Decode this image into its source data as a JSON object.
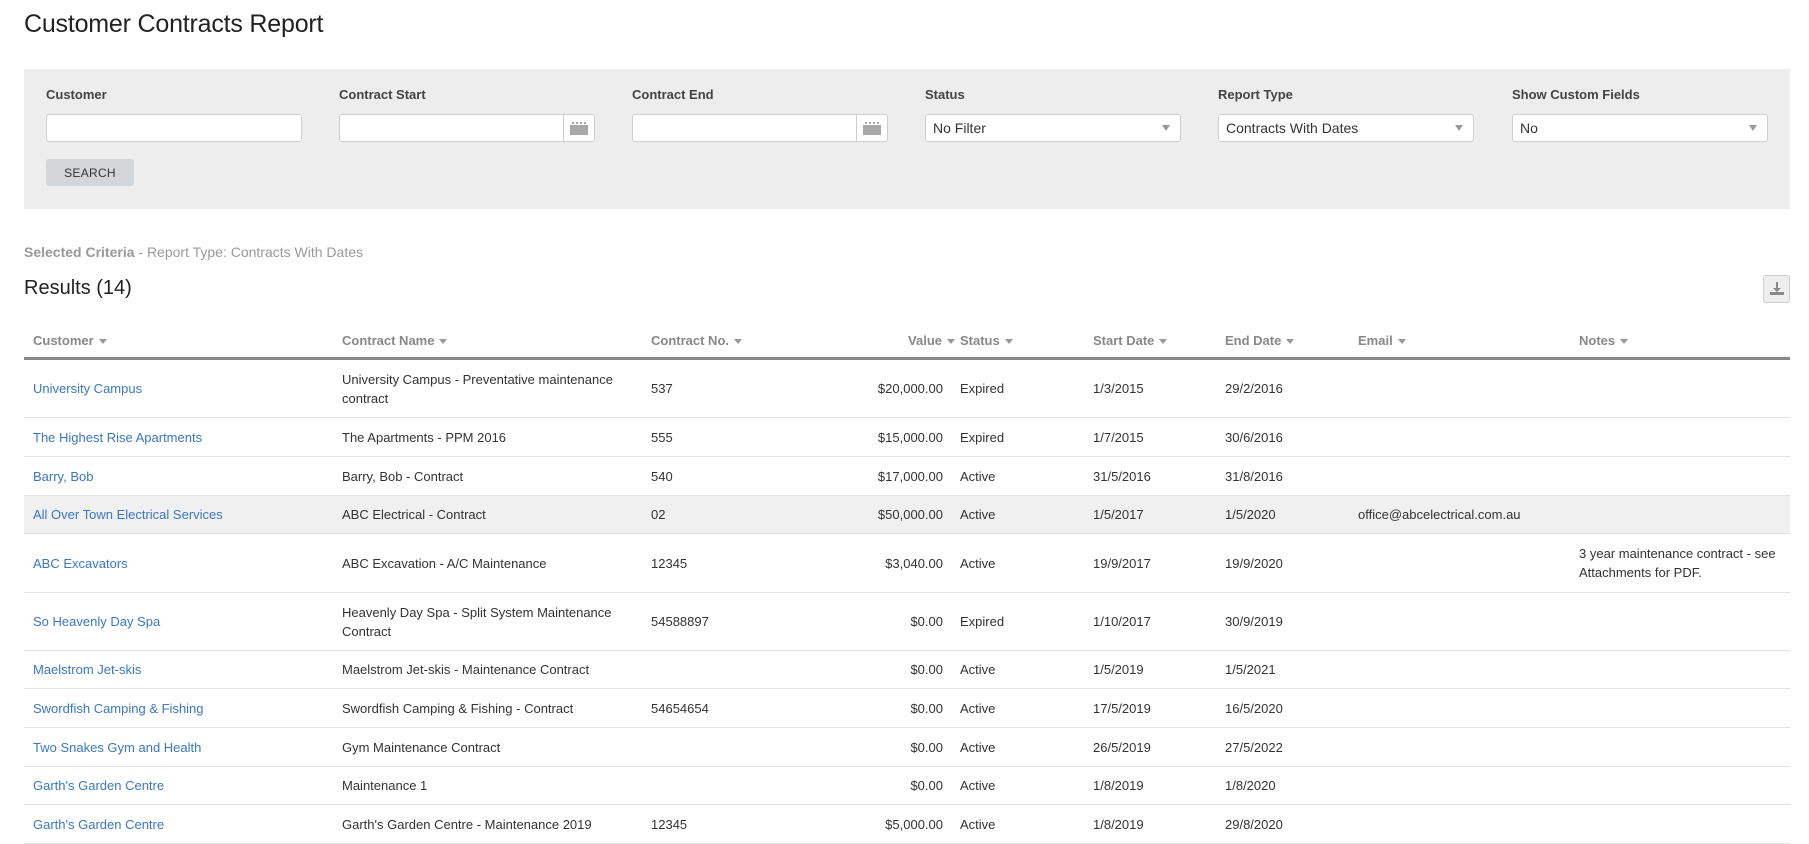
{
  "page": {
    "title": "Customer Contracts Report"
  },
  "filters": {
    "customer": {
      "label": "Customer",
      "value": ""
    },
    "contract_start": {
      "label": "Contract Start",
      "value": "",
      "icon": "calendar-icon"
    },
    "contract_end": {
      "label": "Contract End",
      "value": "",
      "icon": "calendar-icon"
    },
    "status": {
      "label": "Status",
      "selected": "No Filter"
    },
    "report_type": {
      "label": "Report Type",
      "selected": "Contracts With Dates"
    },
    "show_custom_fields": {
      "label": "Show Custom Fields",
      "selected": "No"
    },
    "search_label": "SEARCH"
  },
  "criteria": {
    "label": "Selected Criteria",
    "text": " - Report Type: Contracts With Dates"
  },
  "results": {
    "title": "Results (14)",
    "download_icon": "download-icon"
  },
  "table": {
    "columns": [
      "Customer",
      "Contract Name",
      "Contract No.",
      "Value",
      "Status",
      "Start Date",
      "End Date",
      "Email",
      "Notes"
    ],
    "rows": [
      {
        "customer": "University Campus",
        "name": "University Campus - Preventative maintenance contract",
        "no": "537",
        "value": "$20,000.00",
        "status": "Expired",
        "start": "1/3/2015",
        "end": "29/2/2016",
        "email": "",
        "notes": ""
      },
      {
        "customer": "The Highest Rise Apartments",
        "name": "The Apartments - PPM 2016",
        "no": "555",
        "value": "$15,000.00",
        "status": "Expired",
        "start": "1/7/2015",
        "end": "30/6/2016",
        "email": "",
        "notes": ""
      },
      {
        "customer": "Barry, Bob",
        "name": "Barry, Bob - Contract",
        "no": "540",
        "value": "$17,000.00",
        "status": "Active",
        "start": "31/5/2016",
        "end": "31/8/2016",
        "email": "",
        "notes": ""
      },
      {
        "customer": "All Over Town Electrical Services",
        "name": "ABC Electrical - Contract",
        "no": "02",
        "value": "$50,000.00",
        "status": "Active",
        "start": "1/5/2017",
        "end": "1/5/2020",
        "email": "office@abcelectrical.com.au",
        "notes": ""
      },
      {
        "customer": "ABC Excavators",
        "name": "ABC Excavation - A/C Maintenance",
        "no": "12345",
        "value": "$3,040.00",
        "status": "Active",
        "start": "19/9/2017",
        "end": "19/9/2020",
        "email": "",
        "notes": "3 year maintenance contract - see Attachments for PDF."
      },
      {
        "customer": "So Heavenly Day Spa",
        "name": "Heavenly Day Spa - Split System Maintenance Contract",
        "no": "54588897",
        "value": "$0.00",
        "status": "Expired",
        "start": "1/10/2017",
        "end": "30/9/2019",
        "email": "",
        "notes": ""
      },
      {
        "customer": "Maelstrom Jet-skis",
        "name": "Maelstrom Jet-skis - Maintenance Contract",
        "no": "",
        "value": "$0.00",
        "status": "Active",
        "start": "1/5/2019",
        "end": "1/5/2021",
        "email": "",
        "notes": ""
      },
      {
        "customer": "Swordfish Camping & Fishing",
        "name": "Swordfish Camping & Fishing - Contract",
        "no": "54654654",
        "value": "$0.00",
        "status": "Active",
        "start": "17/5/2019",
        "end": "16/5/2020",
        "email": "",
        "notes": ""
      },
      {
        "customer": "Two Snakes Gym and Health",
        "name": "Gym Maintenance Contract",
        "no": "",
        "value": "$0.00",
        "status": "Active",
        "start": "26/5/2019",
        "end": "27/5/2022",
        "email": "",
        "notes": ""
      },
      {
        "customer": "Garth's Garden Centre",
        "name": "Maintenance 1",
        "no": "",
        "value": "$0.00",
        "status": "Active",
        "start": "1/8/2019",
        "end": "1/8/2020",
        "email": "",
        "notes": ""
      },
      {
        "customer": "Garth's Garden Centre",
        "name": "Garth's Garden Centre - Maintenance 2019",
        "no": "12345",
        "value": "$5,000.00",
        "status": "Active",
        "start": "1/8/2019",
        "end": "29/8/2020",
        "email": "",
        "notes": ""
      }
    ]
  },
  "colors": {
    "link": "#3a77c4",
    "panel": "#ededed",
    "header_text": "#888888",
    "highlight_row": "#f0f0f0"
  }
}
